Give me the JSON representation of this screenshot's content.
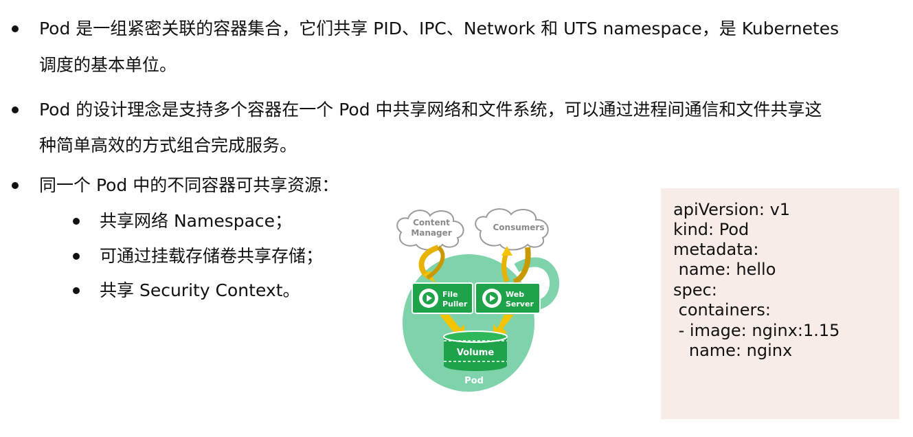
{
  "bullets": [
    {
      "line1": "Pod 是一组紧密关联的容器集合，它们共享 PID、IPC、Network 和 UTS namespace，是 Kubernetes",
      "line2": "调度的基本单位。"
    },
    {
      "line1": "Pod 的设计理念是支持多个容器在一个 Pod 中共享网络和文件系统，可以通过进程间通信和文件共享这",
      "line2": "种简单高效的方式组合完成服务。"
    },
    {
      "line1": "同一个 Pod 中的不同容器可共享资源："
    }
  ],
  "sub_bullets": [
    "共享网络 Namespace；",
    "可通过挂载存储卷共享存储；",
    "共享 Security Context。"
  ],
  "diagram": {
    "content_manager_line1": "Content",
    "content_manager_line2": "Manager",
    "consumers": "Consumers",
    "file_puller_line1": "File",
    "file_puller_line2": "Puller",
    "web_server_line1": "Web",
    "web_server_line2": "Server",
    "volume": "Volume",
    "pod": "Pod",
    "colors": {
      "pod_green": "#7ed3aa",
      "box_green": "#1fa34a",
      "arrow_yellow": "#f5c400",
      "cloud_gray": "#9a9a9a"
    }
  },
  "code": [
    "apiVersion: v1",
    "kind: Pod",
    "metadata:",
    " name: hello",
    "spec:",
    " containers:",
    " - image: nginx:1.15",
    "   name: nginx"
  ],
  "colors": {
    "code_bg": "#f8ece8",
    "text": "#111111"
  }
}
